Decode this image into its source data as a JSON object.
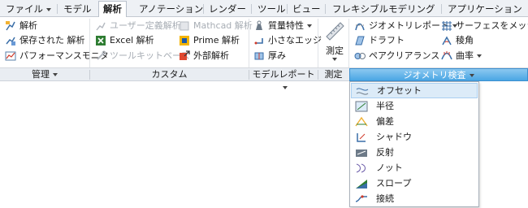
{
  "tabs": [
    {
      "label": "ファイル",
      "dropdown": true
    },
    {
      "label": "モデル"
    },
    {
      "label": "解析",
      "active": true
    },
    {
      "label": "アノテーション"
    },
    {
      "label": "レンダー"
    },
    {
      "label": "ツール"
    },
    {
      "label": "ビュー"
    },
    {
      "label": "フレキシブルモデリング"
    },
    {
      "label": "アプリケーション"
    }
  ],
  "manage": {
    "items": [
      "解析",
      "保存された 解析",
      "パフォーマンスモニタ"
    ],
    "group_label": "管理"
  },
  "custom": {
    "items": [
      "ユーザー定義解析",
      "Mathcad 解析",
      "Excel 解析",
      "Prime 解析",
      "ツールキットベース",
      "外部解析"
    ],
    "group_label": "カスタム"
  },
  "model_report": {
    "items": [
      "質量特性",
      "小さなエッジ",
      "厚み"
    ],
    "group_label": "モデルレポート"
  },
  "measure": {
    "label": "測定",
    "group_label": "測定"
  },
  "geometry_report": {
    "items": [
      "ジオメトリレポート",
      "サーフェスをメッシュ",
      "ドラフト",
      "稜角",
      "ペアクリアランス",
      "曲率"
    ]
  },
  "geometry_check": {
    "group_label": "ジオメトリ検査",
    "menu": [
      "オフセット",
      "半径",
      "偏差",
      "シャドウ",
      "反射",
      "ノット",
      "スロープ",
      "接続"
    ],
    "highlighted": "オフセット"
  },
  "colors": {
    "active_group": "#4aa6e4",
    "menu_highlight": "#dcebf8",
    "disabled_text": "#a7adb4"
  }
}
